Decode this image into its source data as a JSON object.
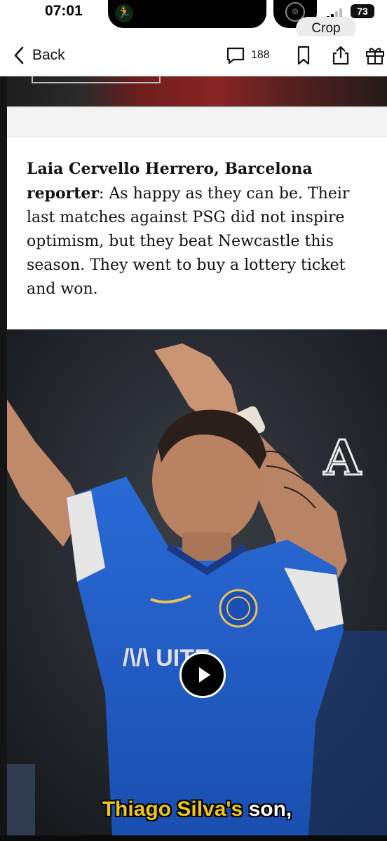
{
  "status_bar": {
    "time": "07:01",
    "battery": "73",
    "crop_label": "Crop"
  },
  "nav": {
    "back_label": "Back",
    "comment_count": "188"
  },
  "article": {
    "speaker": "Laia Cervello Herrero, Barcelona reporter",
    "quote": ": As happy as they can be. Their last matches against PSG did not inspire optimism, but they beat Newcastle this season. They went to buy a lottery ticket and won."
  },
  "video": {
    "logo_letter": "A",
    "caption_yellow": "Thiago Silva's",
    "caption_white": "son,"
  },
  "icons": {
    "back": "chevron-left-icon",
    "comments": "comment-icon",
    "bookmark": "bookmark-icon",
    "share": "share-icon",
    "gift": "gift-icon",
    "play": "play-icon"
  },
  "colors": {
    "caption_yellow": "#f0c419",
    "chelsea_blue": "#1b5bc8"
  }
}
